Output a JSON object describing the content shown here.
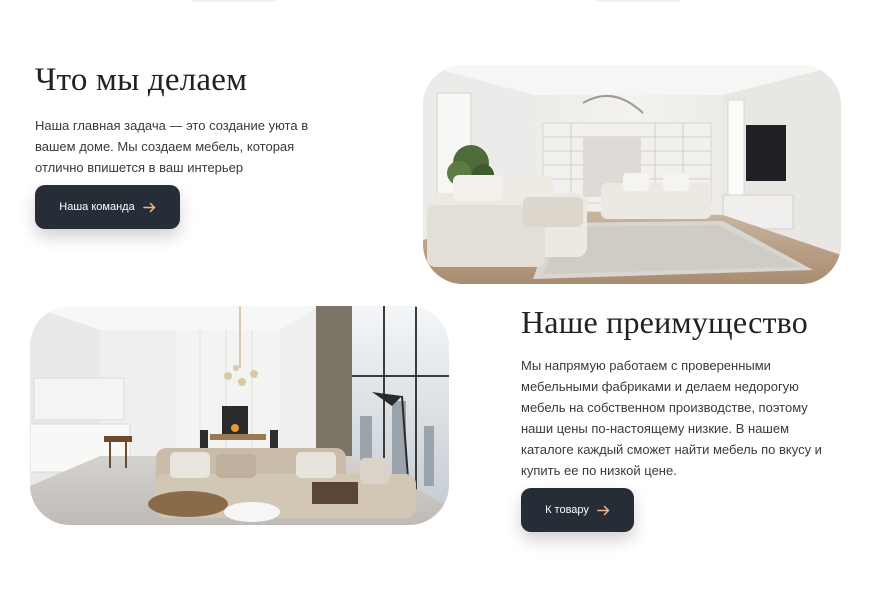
{
  "section_1": {
    "title": "Что мы делаем",
    "text": "Наша главная задача — это создание уюта в вашем доме. Мы создаем мебель, которая отлично впишется в ваш интерьер",
    "button_label": "Наша команда",
    "photo": "living-room-photo"
  },
  "section_2": {
    "title": "Наше преимущество",
    "text": "Мы напрямую работаем с проверенными мебельными фабриками и делаем недорогую мебель на собственном производстве, поэтому наши цены по-настоящему низкие. В нашем каталоге каждый сможет найти мебель по вкусу и купить ее по низкой цене.",
    "button_label": "К товару",
    "photo": "loft-living-room-photo"
  },
  "colors": {
    "button_bg": "#262d36",
    "button_text": "#ffffff",
    "heading": "#222222",
    "body_text": "#3a3a3a"
  },
  "icons": {
    "button_arrow": "arrow-right-icon"
  }
}
